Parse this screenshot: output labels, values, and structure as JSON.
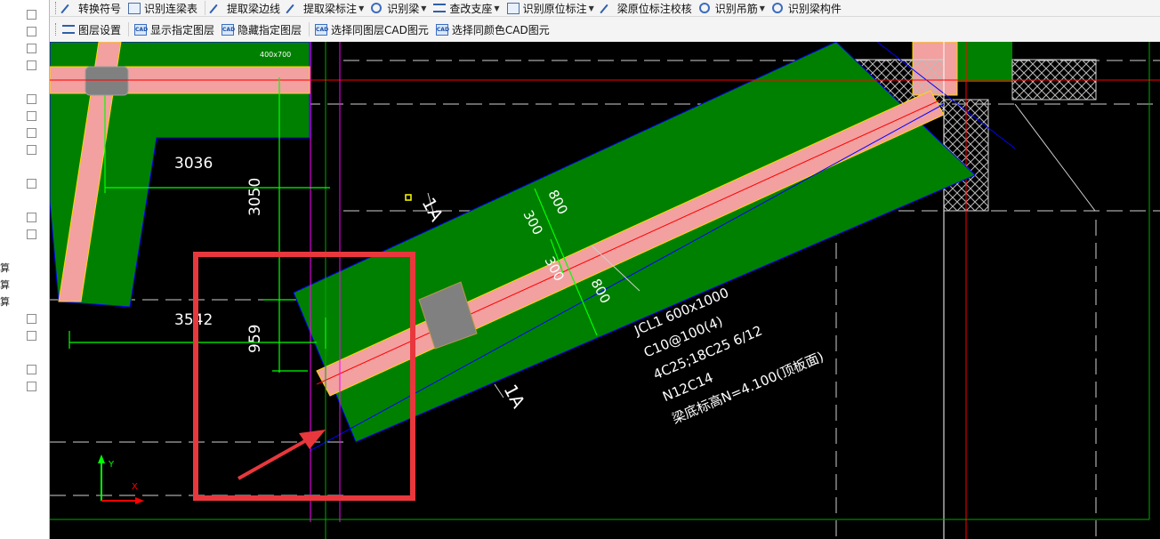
{
  "toolbar_row1": [
    {
      "label": "转换符号",
      "icon": "convert-symbol-icon",
      "dropdown": false
    },
    {
      "label": "识别连梁表",
      "icon": "table-icon",
      "dropdown": false
    },
    {
      "label": "提取梁边线",
      "icon": "beam-edge-icon",
      "dropdown": false
    },
    {
      "label": "提取梁标注",
      "icon": "beam-label-icon",
      "dropdown": true
    },
    {
      "label": "识别梁",
      "icon": "identify-beam-icon",
      "dropdown": true
    },
    {
      "label": "查改支座",
      "icon": "support-icon",
      "dropdown": true
    },
    {
      "label": "识别原位标注",
      "icon": "in-situ-label-icon",
      "dropdown": true
    },
    {
      "label": "梁原位标注校核",
      "icon": "check-icon",
      "dropdown": false
    },
    {
      "label": "识别吊筋",
      "icon": "hanger-icon",
      "dropdown": true
    },
    {
      "label": "识别梁构件",
      "icon": "beam-member-icon",
      "dropdown": false
    }
  ],
  "toolbar_row2": [
    {
      "label": "图层设置",
      "icon": "layer-settings-icon"
    },
    {
      "label": "显示指定图层",
      "icon": "cad-show-layer-icon"
    },
    {
      "label": "隐藏指定图层",
      "icon": "cad-hide-layer-icon"
    },
    {
      "label": "选择同图层CAD图元",
      "icon": "cad-select-layer-icon"
    },
    {
      "label": "选择同颜色CAD图元",
      "icon": "cad-select-color-icon"
    }
  ],
  "left_panel_chars": [
    "算",
    "算",
    "算"
  ],
  "drawing": {
    "dim_3036": "3036",
    "dim_3050": "3050",
    "dim_3542": "3542",
    "dim_959": "959",
    "dim_400x700": "400x700",
    "dim_800_top": "800",
    "dim_300_a": "300",
    "dim_300_b": "300",
    "dim_800_bottom": "800",
    "section_mark_top": "1A",
    "section_mark_bottom": "1A",
    "beam_label_1": "JCL1 600x1000",
    "beam_label_2": "C10@100(4)",
    "beam_label_3": "4C25;18C25 6/12",
    "beam_label_4": "N12C14",
    "beam_label_5": "梁底标高N=4.100(顶板面)",
    "axis_y": "Y",
    "axis_x": "X"
  },
  "colors": {
    "canvas_bg": "#000000",
    "slab_green": "#008000",
    "beam_pink": "#f2a0a0",
    "beam_edge_yellow": "#ffd700",
    "axis_red": "#ff0000",
    "dim_green": "#00ff00",
    "guide_magenta": "#ff00ff",
    "highlight_red": "#e8383d"
  }
}
